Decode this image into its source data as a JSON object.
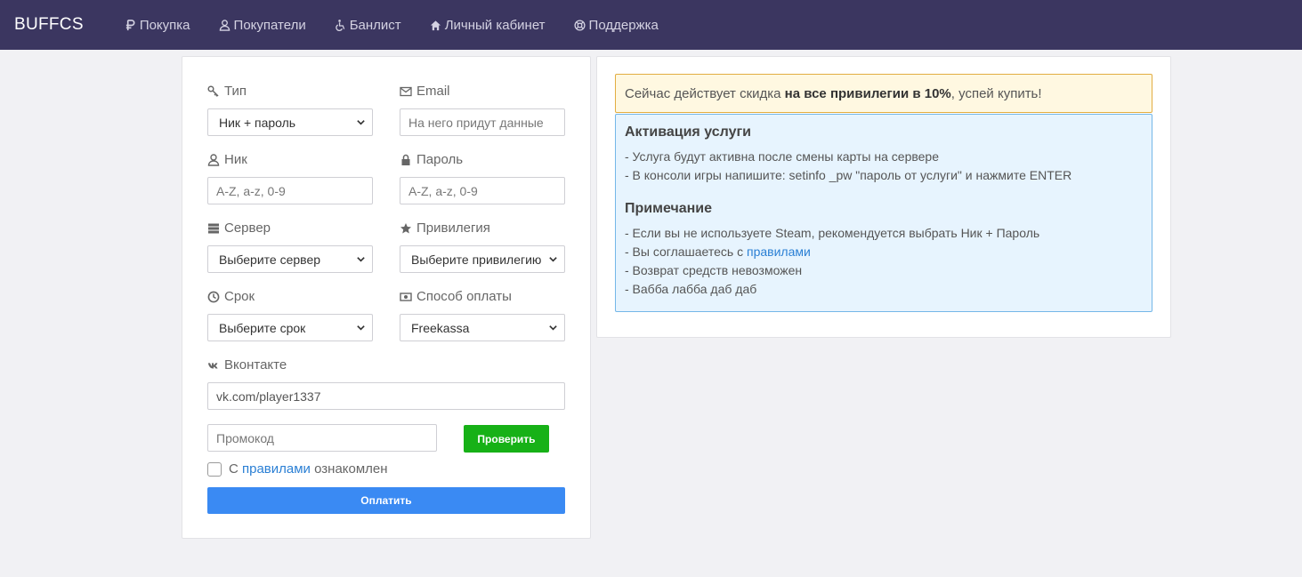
{
  "nav": {
    "brand": "BUFFCS",
    "items": [
      {
        "label": "Покупка",
        "icon": "ruble-icon"
      },
      {
        "label": "Покупатели",
        "icon": "user-icon"
      },
      {
        "label": "Банлист",
        "icon": "wheelchair-icon"
      },
      {
        "label": "Личный кабинет",
        "icon": "home-icon"
      },
      {
        "label": "Поддержка",
        "icon": "life-ring-icon"
      }
    ]
  },
  "form": {
    "type_label": "Тип",
    "type_value": "Ник + пароль",
    "email_label": "Email",
    "email_placeholder": "На него придут данные",
    "nick_label": "Ник",
    "nick_placeholder": "A-Z, a-z, 0-9",
    "password_label": "Пароль",
    "password_placeholder": "A-Z, a-z, 0-9",
    "server_label": "Сервер",
    "server_value": "Выберите сервер",
    "privilege_label": "Привилегия",
    "privilege_value": "Выберите привилегию",
    "term_label": "Срок",
    "term_value": "Выберите срок",
    "payment_label": "Способ оплаты",
    "payment_value": "Freekassa",
    "vk_label": "Вконтакте",
    "vk_value": "vk.com/player1337",
    "promo_placeholder": "Промокод",
    "check_button": "Проверить",
    "agree_prefix": "С ",
    "agree_link": "правилами",
    "agree_suffix": " ознакомлен",
    "pay_button": "Оплатить"
  },
  "info": {
    "discount_prefix": "Сейчас действует скидка ",
    "discount_bold": "на все привилегии в 10%",
    "discount_suffix": ", успей купить!",
    "activation_title": "Активация услуги",
    "activation_lines": [
      "- Услуга будут активна после смены карты на сервере",
      "- В консоли игры напишите: setinfo _pw \"пароль от услуги\" и нажмите ENTER"
    ],
    "note_title": "Примечание",
    "note_line1": "- Если вы не используете Steam, рекомендуется выбрать Ник + Пароль",
    "note_line2_prefix": "- Вы соглашаетесь с ",
    "note_line2_link": "правилами",
    "note_line3": "- Возврат средств невозможен",
    "note_line4": "- Вабба лабба даб даб"
  },
  "colors": {
    "navbar": "#3b3660",
    "check_button": "#17b117",
    "pay_button": "#3a8af3",
    "link": "#2a7fd4"
  }
}
